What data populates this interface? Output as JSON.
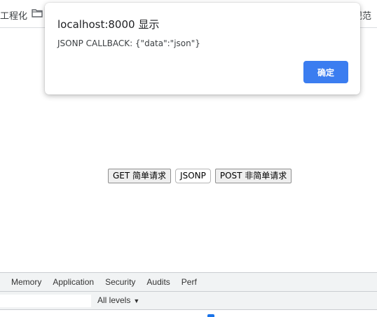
{
  "bookmarks": {
    "left_fragment": "工程化",
    "folder_icon": "folder-icon",
    "right_fragment": "规范"
  },
  "page": {
    "buttons": [
      "GET 简单请求",
      "JSONP",
      "POST 非简单请求"
    ]
  },
  "dialog": {
    "title": "localhost:8000 显示",
    "message": "JSONP CALLBACK:  {\"data\":\"json\"}",
    "ok_label": "确定",
    "ok_color": "#3b7df0"
  },
  "devtools": {
    "tabs": [
      "Memory",
      "Application",
      "Security",
      "Audits",
      "Perf"
    ],
    "levels_label": "All levels",
    "levels_caret": "▼"
  }
}
